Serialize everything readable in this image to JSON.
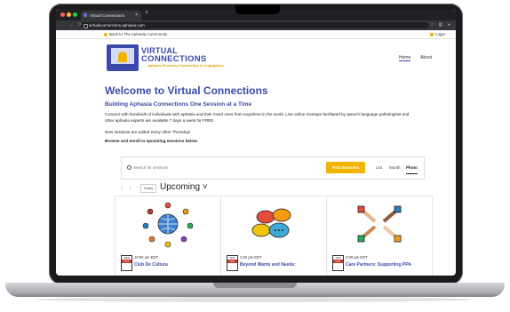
{
  "browser": {
    "tab_title": "Virtual Connections",
    "tab_close": "×",
    "new_tab": "+",
    "nav_glyphs": "← → ⟳",
    "url": "virtualconnections.aphasia.com",
    "right_glyphs": "☆ ◧ ●"
  },
  "topbar": {
    "back_link": "Back to The Aphasia Community",
    "login": "Login"
  },
  "header": {
    "logo_line1": "VIRTUAL",
    "logo_line2": "CONNECTIONS",
    "logo_tagline": "Aphasia Recovery Connection & Lingraphica",
    "nav": [
      "Home",
      "About"
    ]
  },
  "main": {
    "title": "Welcome to Virtual Connections",
    "subtitle": "Building Aphasia Connections One Session at a Time",
    "intro": "Connect with hundreds of individuals with aphasia and their loved ones from anywhere in the world. Live online meetups facilitated by speech-language pathologists and other aphasia experts are available 7 days a week for FREE.",
    "note": "New sessions are added every other Thursday!",
    "cta": "Browse and enroll in upcoming sessions below."
  },
  "search": {
    "placeholder": "Search for sessions",
    "button": "Find Sessions",
    "views": [
      "List",
      "Month",
      "Photo"
    ],
    "active_view": "Photo"
  },
  "toolbar": {
    "prev": "‹",
    "next": "›",
    "today": "Today",
    "range": "Upcoming ˅"
  },
  "events": [
    {
      "weekday": "WED",
      "month": "OCT",
      "time": "10:00 am EDT",
      "title": "Club De Cultura"
    },
    {
      "weekday": "THU",
      "month": "OCT",
      "time": "1:00 pm EDT",
      "title": "Beyond Wants and Needs:"
    },
    {
      "weekday": "THU",
      "month": "OCT",
      "time": "2:00 pm EDT",
      "title": "Care Partners: Supporting PPA"
    }
  ],
  "colors": {
    "brand_blue": "#3b4aa8",
    "accent_yellow": "#f2b400",
    "calendar_red": "#c0392b"
  }
}
